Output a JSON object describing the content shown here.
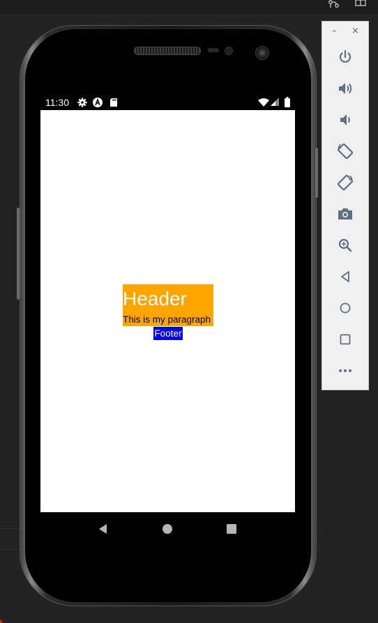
{
  "status_bar": {
    "time": "11:30",
    "left_icons": [
      "gear-icon",
      "a-icon",
      "sd-card-icon"
    ],
    "right_icons": [
      "wifi-icon",
      "signal-icon",
      "battery-icon"
    ]
  },
  "app": {
    "header": "Header",
    "paragraph": "This is my paragraph",
    "footer": "Footer",
    "colors": {
      "header_bg": "#ffa500",
      "paragraph_bg": "#ffa500",
      "footer_bg": "#0000ff",
      "screen_bg": "#ffffff"
    }
  },
  "nav_bar": {
    "buttons": [
      "back-icon",
      "home-icon",
      "recents-icon"
    ]
  },
  "emulator_panel": {
    "minimize": "–",
    "close": "×",
    "buttons": [
      "power-icon",
      "volume-up-icon",
      "volume-down-icon",
      "rotate-left-icon",
      "rotate-right-icon",
      "camera-icon",
      "zoom-icon",
      "back-icon",
      "home-icon",
      "overview-icon",
      "more-icon"
    ]
  }
}
